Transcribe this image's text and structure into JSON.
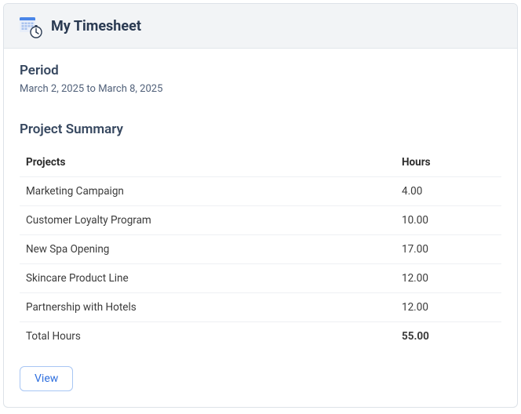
{
  "header": {
    "title": "My Timesheet"
  },
  "period": {
    "heading": "Period",
    "range": "March 2, 2025 to March 8, 2025"
  },
  "summary": {
    "heading": "Project Summary",
    "columns": {
      "projects": "Projects",
      "hours": "Hours"
    },
    "rows": [
      {
        "project": "Marketing Campaign",
        "hours": "4.00"
      },
      {
        "project": "Customer Loyalty Program",
        "hours": "10.00"
      },
      {
        "project": "New Spa Opening",
        "hours": "17.00"
      },
      {
        "project": "Skincare Product Line",
        "hours": "12.00"
      },
      {
        "project": "Partnership with Hotels",
        "hours": "12.00"
      }
    ],
    "total": {
      "label": "Total Hours",
      "value": "55.00"
    }
  },
  "actions": {
    "view": "View"
  }
}
